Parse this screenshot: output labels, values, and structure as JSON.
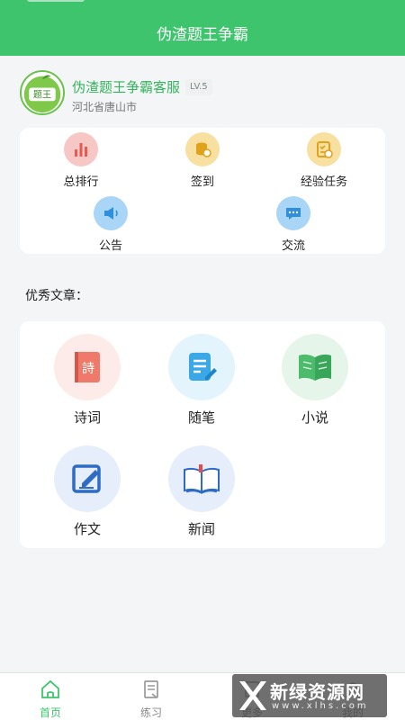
{
  "header": {
    "title": "伪渣题王争霸"
  },
  "profile": {
    "avatar_text": "题王",
    "username": "伪渣题王争霸客服",
    "level": "LV.5",
    "location": "河北省唐山市"
  },
  "menu": {
    "items": [
      {
        "label": "总排行",
        "icon": "bar-chart-icon",
        "bg": "#f6c7c4",
        "fg": "#e55b4f"
      },
      {
        "label": "签到",
        "icon": "coin-stack-icon",
        "bg": "#f8e0a0",
        "fg": "#e0a11c"
      },
      {
        "label": "经验任务",
        "icon": "task-checklist-icon",
        "bg": "#f8e0a0",
        "fg": "#e0a11c"
      },
      {
        "label": "公告",
        "icon": "speaker-icon",
        "bg": "#a9d5f6",
        "fg": "#2f8fdc"
      },
      {
        "label": "交流",
        "icon": "chat-bubble-icon",
        "bg": "#a9d5f6",
        "fg": "#2f8fdc"
      }
    ]
  },
  "articles": {
    "title": "优秀文章：",
    "items": [
      {
        "label": "诗词",
        "icon": "poem-book-icon",
        "bg": "#fdebe9",
        "glyph": "詩"
      },
      {
        "label": "随笔",
        "icon": "notepad-pen-icon",
        "bg": "#e4f4fc"
      },
      {
        "label": "小说",
        "icon": "open-book-icon",
        "bg": "#e6f5ea"
      },
      {
        "label": "作文",
        "icon": "edit-document-icon",
        "bg": "#e6eefb"
      },
      {
        "label": "新闻",
        "icon": "news-book-icon",
        "bg": "#e6eefb"
      }
    ]
  },
  "tabbar": {
    "items": [
      {
        "label": "首页",
        "icon": "home-icon",
        "active": true
      },
      {
        "label": "练习",
        "icon": "practice-icon",
        "active": false
      },
      {
        "label": "更多",
        "icon": "more-icon",
        "active": false
      },
      {
        "label": "我的",
        "icon": "profile-icon",
        "active": false
      }
    ],
    "active_color": "#3ec46d"
  },
  "watermark": {
    "text": "新绿资源网",
    "sub": "www.xlhs.com"
  },
  "colors": {
    "brand": "#3ec46d",
    "background": "#f4f5f6"
  }
}
